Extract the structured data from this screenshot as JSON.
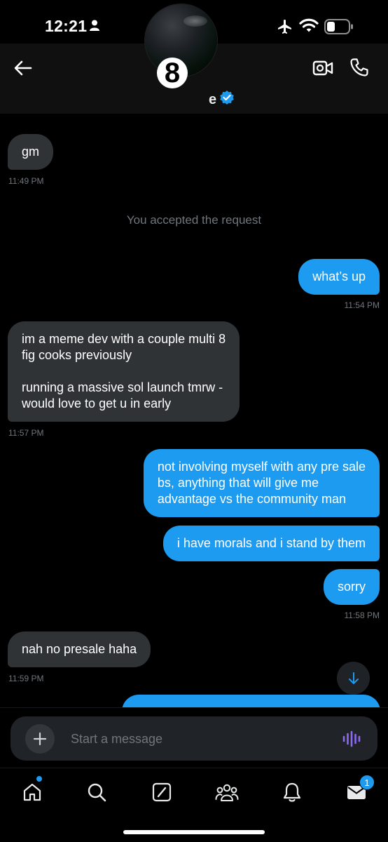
{
  "status_bar": {
    "time": "12:21"
  },
  "header": {
    "avatar_digit": "8",
    "name_fragment": "e"
  },
  "messages": [
    {
      "text": "gm",
      "time": "11:49 PM"
    },
    {
      "system": "You accepted the request"
    },
    {
      "text": "what’s up",
      "time": "11:54 PM"
    },
    {
      "text": "im a meme dev with a couple multi 8\nfig cooks previously\n\nrunning a massive sol launch tmrw -\nwould love to get u in early",
      "time": "11:57 PM"
    },
    {
      "text": "not involving myself with any pre sale\nbs, anything that will give me\nadvantage vs the community man"
    },
    {
      "text": "i have morals and i stand by them"
    },
    {
      "text": "sorry",
      "time": "11:58 PM"
    },
    {
      "text": "nah no presale haha",
      "time": "11:59 PM"
    }
  ],
  "composer": {
    "placeholder": "Start a message"
  },
  "nav": {
    "messages_badge": "1"
  },
  "colors": {
    "accent": "#1d9bf0",
    "incoming_bubble": "#2f3336",
    "voice_icon": "#8b6cf0"
  }
}
